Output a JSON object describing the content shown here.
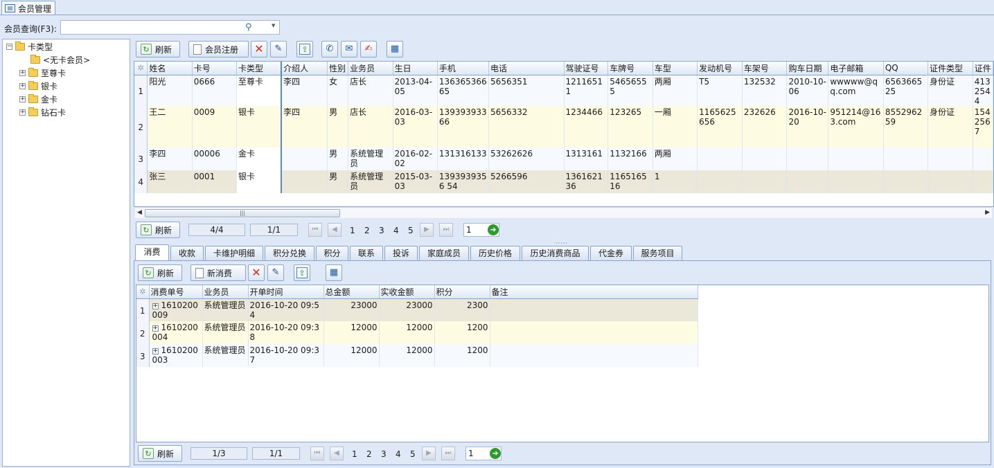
{
  "window": {
    "tab_title": "会员管理"
  },
  "search": {
    "label": "会员查询(F3):",
    "value": "",
    "placeholder": ""
  },
  "tree": {
    "root": "卡类型",
    "items": [
      "<无卡会员>",
      "至尊卡",
      "银卡",
      "金卡",
      "钻石卡"
    ]
  },
  "toolbar": {
    "refresh": "刷新",
    "register": "会员注册"
  },
  "members": {
    "columns": [
      "姓名",
      "卡号",
      "卡类型",
      "介绍人",
      "性别",
      "业务员",
      "生日",
      "手机",
      "电话",
      "驾驶证号",
      "车牌号",
      "车型",
      "发动机号",
      "车架号",
      "购车日期",
      "电子邮箱",
      "QQ",
      "证件类型",
      "证件"
    ],
    "rows": [
      [
        "1",
        "阳光",
        "0666",
        "至尊卡",
        "李四",
        "女",
        "店长",
        "2013-04-05",
        "13636536665",
        "5656351",
        "12116511",
        "54656555",
        "两厢",
        "T5",
        "132532",
        "2010-10-06",
        "wwwww@qq.com",
        "656366525",
        "身份证",
        "4132544"
      ],
      [
        "2",
        "王二",
        "0009",
        "银卡",
        "李四",
        "男",
        "店长",
        "2016-03-03",
        "13939393366",
        "5656332",
        "1234466",
        "123265",
        "一厢",
        "1165625656",
        "232626",
        "2016-10-20",
        "951214@163.com",
        "855296259",
        "身份证",
        "1542567"
      ],
      [
        "3",
        "李四",
        "00006",
        "金卡",
        "",
        "男",
        "系统管理员",
        "2016-02-02",
        "131316133",
        "53262626",
        "1313161",
        "1132166",
        "两厢",
        "",
        "",
        "",
        "",
        "",
        "",
        ""
      ],
      [
        "4",
        "张三",
        "0001",
        "银卡",
        "",
        "男",
        "系统管理员",
        "2015-03-03",
        "1393939356 54",
        "5266596",
        "136162136",
        "116516516",
        "1",
        "",
        "",
        "",
        "",
        "",
        "",
        ""
      ]
    ]
  },
  "pager_top": {
    "refresh": "刷新",
    "records": "4/4",
    "pages": "1/1",
    "page_numbers": [
      "1",
      "2",
      "3",
      "4",
      "5"
    ],
    "goto": "1"
  },
  "tabs": [
    "消费",
    "收款",
    "卡维护明细",
    "积分兑换",
    "积分",
    "联系",
    "投诉",
    "家庭成员",
    "历史价格",
    "历史消费商品",
    "代金券",
    "服务项目"
  ],
  "sub_toolbar": {
    "refresh": "刷新",
    "new_consume": "新消费"
  },
  "consume": {
    "columns": [
      "消费单号",
      "业务员",
      "开单时间",
      "总金额",
      "实收金额",
      "积分",
      "备注"
    ],
    "rows": [
      [
        "1",
        "1610200009",
        "系统管理员",
        "2016-10-20 09:54",
        "23000",
        "23000",
        "2300",
        ""
      ],
      [
        "2",
        "1610200004",
        "系统管理员",
        "2016-10-20 09:38",
        "12000",
        "12000",
        "1200",
        ""
      ],
      [
        "3",
        "1610200003",
        "系统管理员",
        "2016-10-20 09:37",
        "12000",
        "12000",
        "1200",
        ""
      ]
    ]
  },
  "pager_bottom": {
    "refresh": "刷新",
    "records": "1/3",
    "pages": "1/1",
    "page_numbers": [
      "1",
      "2",
      "3",
      "4",
      "5"
    ],
    "goto": "1"
  }
}
